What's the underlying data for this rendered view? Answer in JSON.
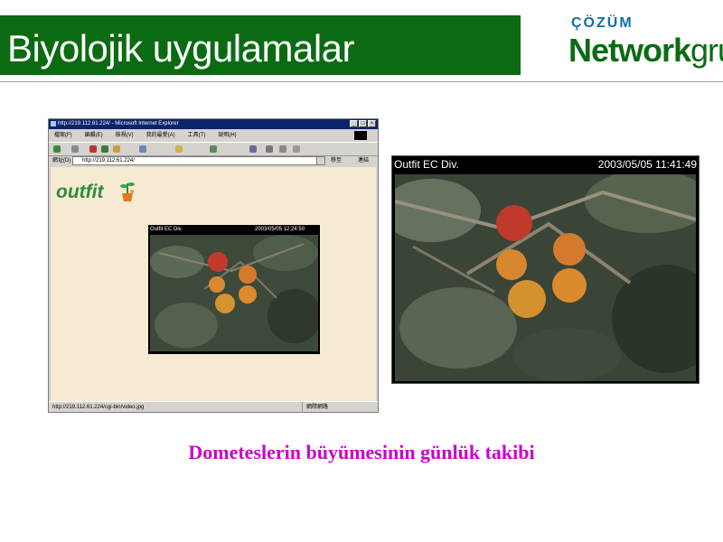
{
  "slide": {
    "title": "Biyolojik uygulamalar",
    "caption": "Dometeslerin büyümesinin günlük takibi"
  },
  "logo": {
    "top_text": "ÇÖZÜM",
    "network_text": "Network",
    "grup_text": "grup"
  },
  "browser": {
    "title_text": "http://219.112.61.224/ - Microsoft Internet Explorer",
    "menu": [
      "檔案(F)",
      "編輯(E)",
      "檢視(V)",
      "我的最愛(A)",
      "工具(T)",
      "說明(H)"
    ],
    "address_label": "網址(D)",
    "address_value": "http://219.112.61.224/",
    "go_label": "移至",
    "links_label": "連結",
    "status_url": "http://219.112.61.224/cgi-bin/video.jpg",
    "status_zone": "網際網路",
    "site_logo_text": "outfit"
  },
  "cam_small": {
    "title": "Outfit EC Div.",
    "timestamp": "2003/05/05 12:24:50"
  },
  "cam_large": {
    "title": "Outfit EC Div.",
    "timestamp": "2003/05/05 11:41:49"
  },
  "colors": {
    "title_bar": "#0b6b12",
    "caption": "#cc00cc",
    "logo_blue": "#0f6fa8",
    "browser_chrome": "#d6d3ce",
    "page_bg": "#f6ebd2"
  }
}
